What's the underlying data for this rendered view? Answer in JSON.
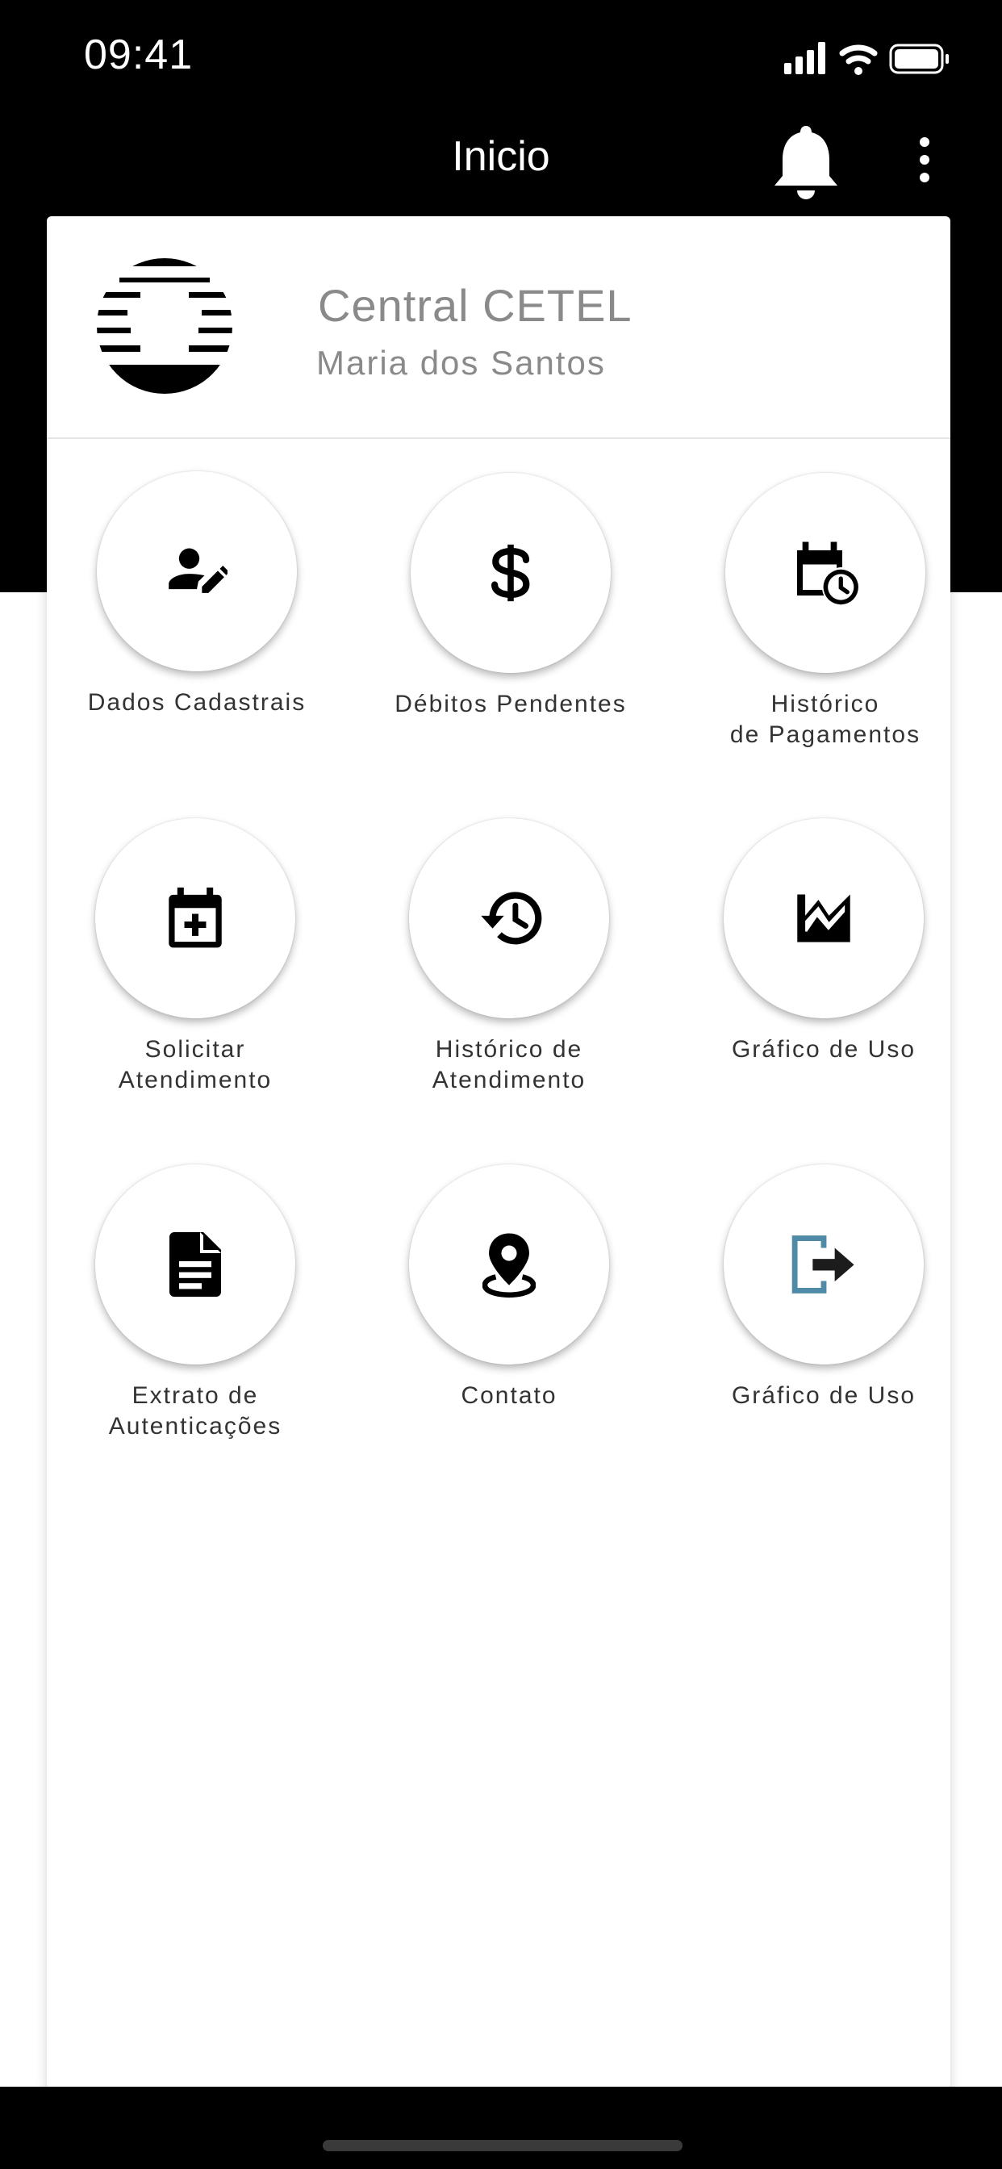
{
  "status_bar": {
    "time": "09:41"
  },
  "nav": {
    "title": "Inicio"
  },
  "profile": {
    "name": "Central CETEL",
    "user": "Maria dos Santos"
  },
  "menu": [
    {
      "label": "Dados Cadastrais",
      "icon": "person-edit-icon"
    },
    {
      "label": "Débitos Pendentes",
      "icon": "dollar-icon"
    },
    {
      "label": "Histórico\nde Pagamentos",
      "icon": "calendar-clock-icon"
    },
    {
      "label": "Solicitar\nAtendimento",
      "icon": "calendar-add-icon"
    },
    {
      "label": "Histórico de\nAtendimento",
      "icon": "history-icon"
    },
    {
      "label": "Gráfico de Uso",
      "icon": "area-chart-icon"
    },
    {
      "label": "Extrato de\nAutenticações",
      "icon": "document-icon"
    },
    {
      "label": "Contato",
      "icon": "location-pin-icon"
    },
    {
      "label": "Gráfico de Uso",
      "icon": "logout-icon"
    }
  ],
  "colors": {
    "header_background": "#000000",
    "logout_icon": "#4f8aa6",
    "logout_arrow": "#1c1c1c"
  }
}
